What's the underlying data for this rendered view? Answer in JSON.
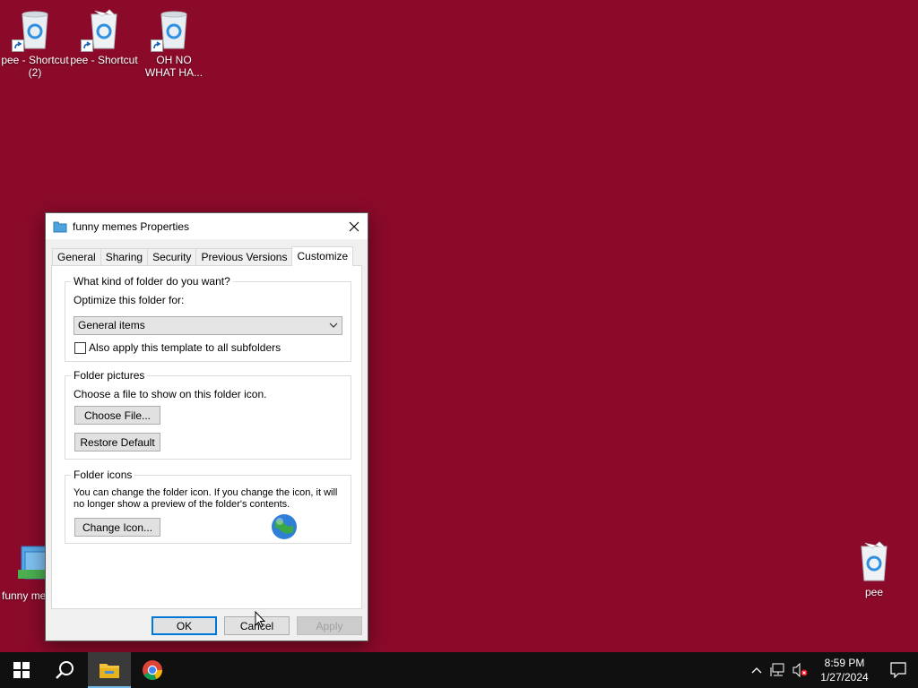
{
  "desktop": {
    "icons": [
      {
        "label": "pee - Shortcut (2)"
      },
      {
        "label": "pee - Shortcut"
      },
      {
        "label": "OH NO WHAT HA..."
      },
      {
        "label": "funny me"
      },
      {
        "label": "pee"
      }
    ],
    "background_color": "#8b0a2a"
  },
  "window": {
    "title": "funny memes Properties",
    "tabs": [
      "General",
      "Sharing",
      "Security",
      "Previous Versions",
      "Customize"
    ],
    "active_tab": "Customize",
    "folder_type": {
      "legend": "What kind of folder do you want?",
      "optimize_label": "Optimize this folder for:",
      "selected": "General items",
      "subfolders_label": "Also apply this template to all subfolders",
      "subfolders_checked": false
    },
    "folder_pictures": {
      "legend": "Folder pictures",
      "description": "Choose a file to show on this folder icon.",
      "choose_button": "Choose File...",
      "restore_button": "Restore Default"
    },
    "folder_icons": {
      "legend": "Folder icons",
      "description_line1": "You can change the folder icon. If you change the icon, it will",
      "description_line2": "no longer show a preview of the folder's contents.",
      "change_button": "Change Icon..."
    },
    "footer": {
      "ok": "OK",
      "cancel": "Cancel",
      "apply": "Apply"
    }
  },
  "taskbar": {
    "time": "8:59 PM",
    "date": "1/27/2024",
    "pinned": [
      "start-icon",
      "search-icon",
      "file-explorer-icon",
      "chrome-icon"
    ]
  }
}
